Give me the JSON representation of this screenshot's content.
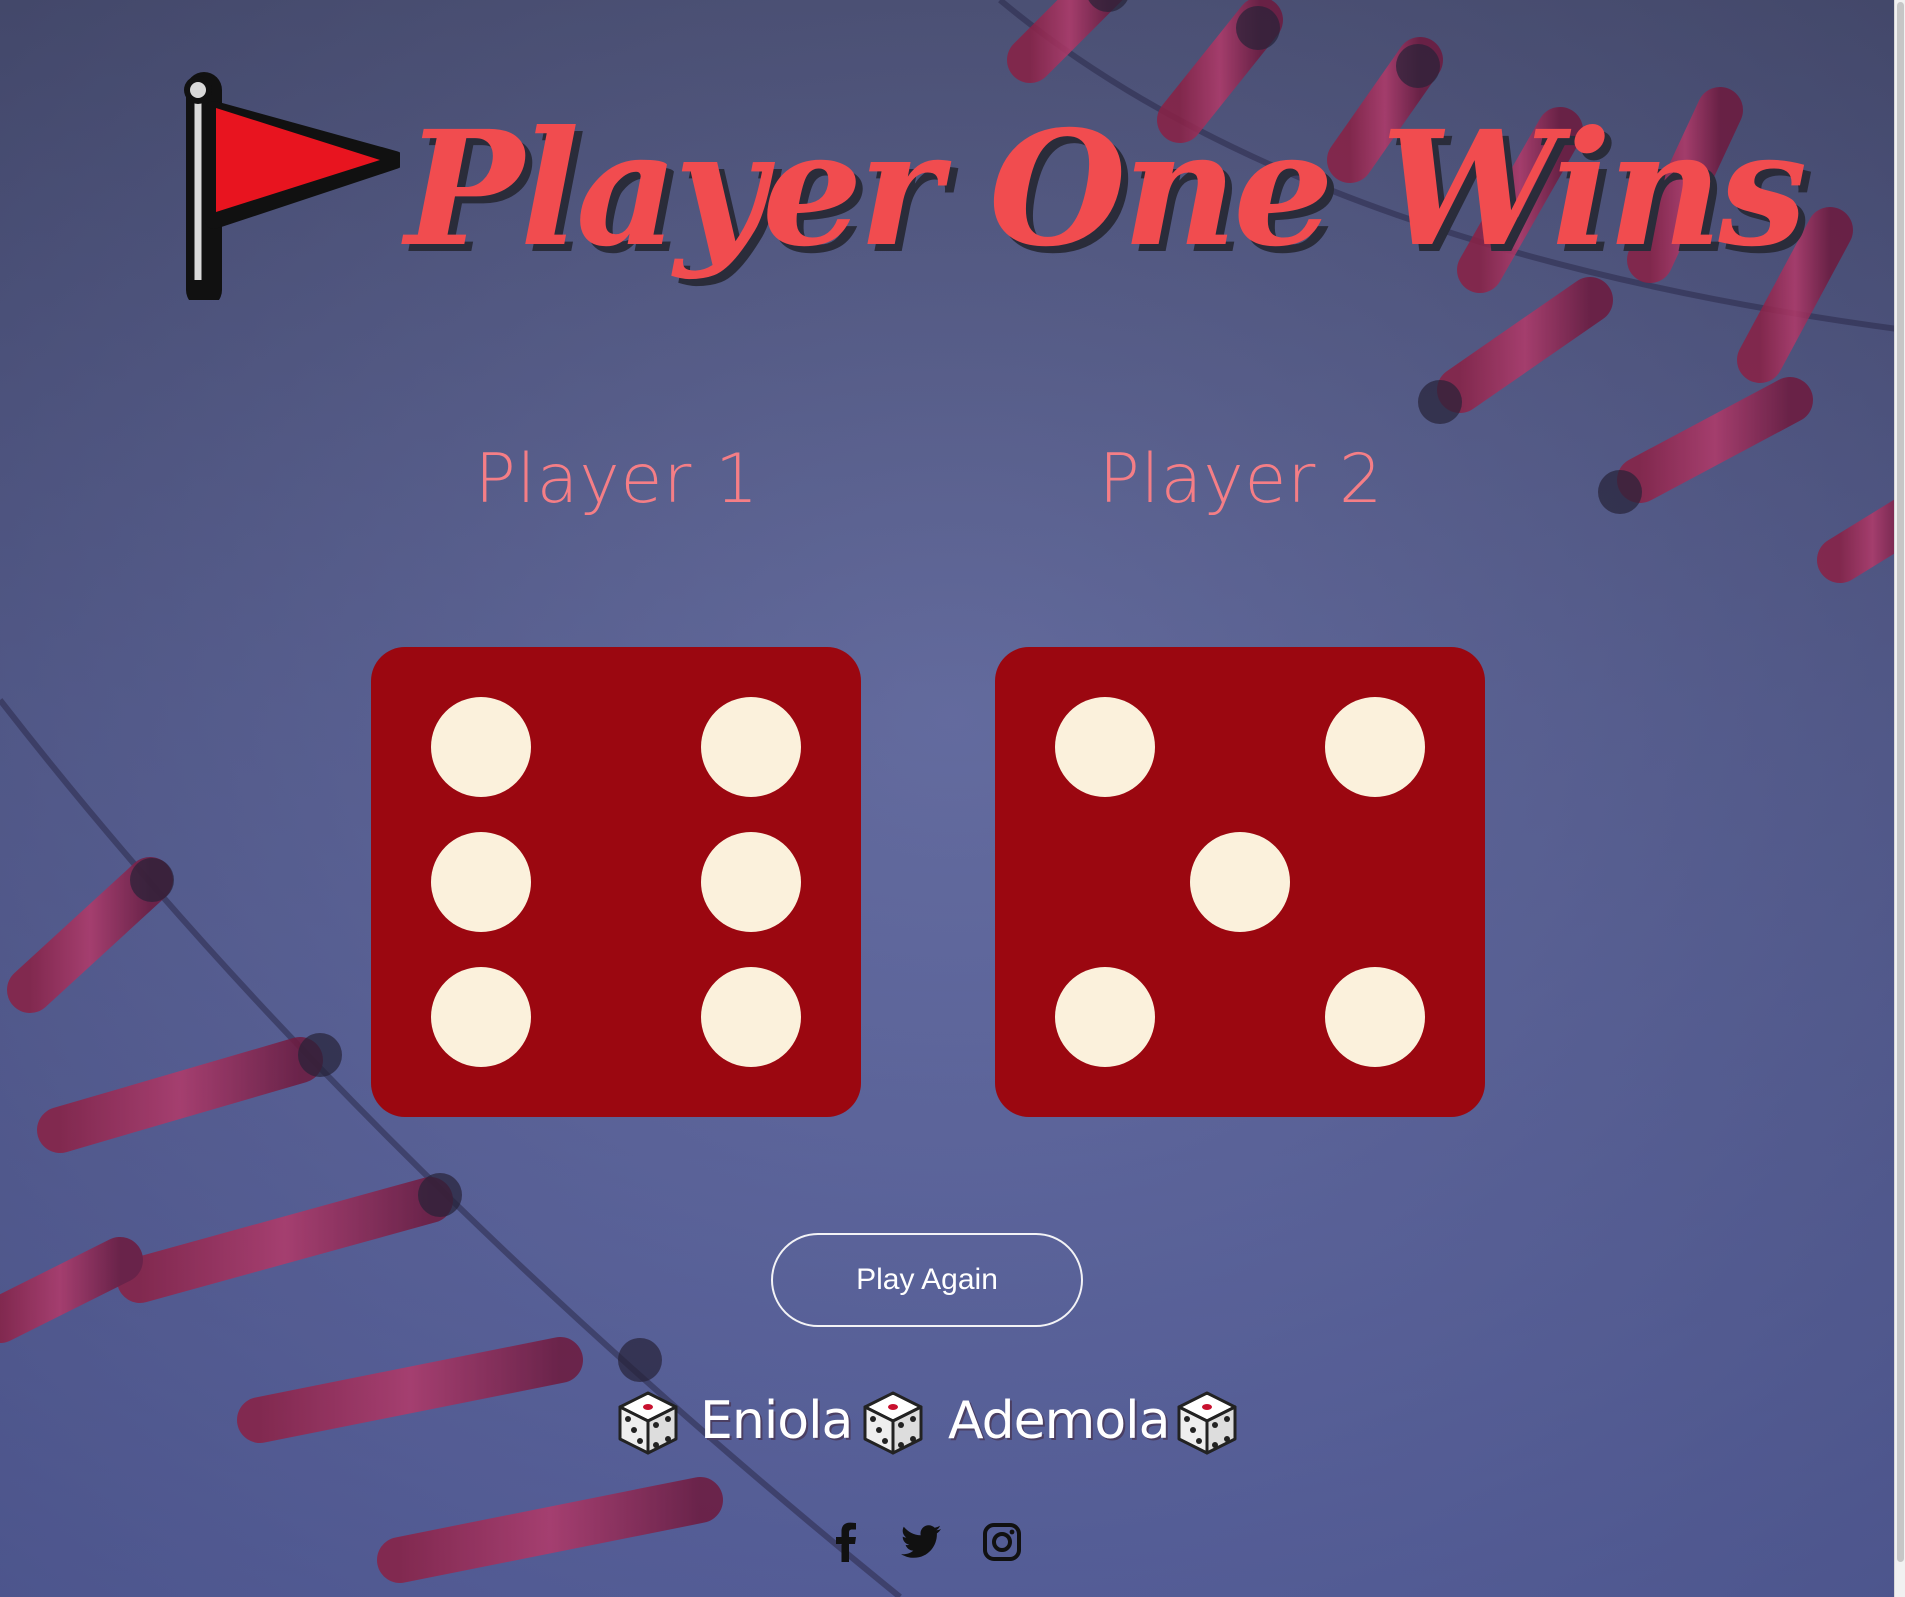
{
  "title": "Player One Wins",
  "players": [
    {
      "label": "Player 1",
      "die_value": 6
    },
    {
      "label": "Player 2",
      "die_value": 5
    }
  ],
  "play_again_label": "Play Again",
  "credits": {
    "names": [
      "Eniola",
      "Ademola"
    ]
  },
  "social_icons": [
    "facebook-icon",
    "twitter-icon",
    "instagram-icon"
  ],
  "colors": {
    "title": "#f14c4f",
    "player_label": "#f57e86",
    "die_face": "#9b0710",
    "pip": "#fbf1dc",
    "flag": "#e8141f"
  }
}
